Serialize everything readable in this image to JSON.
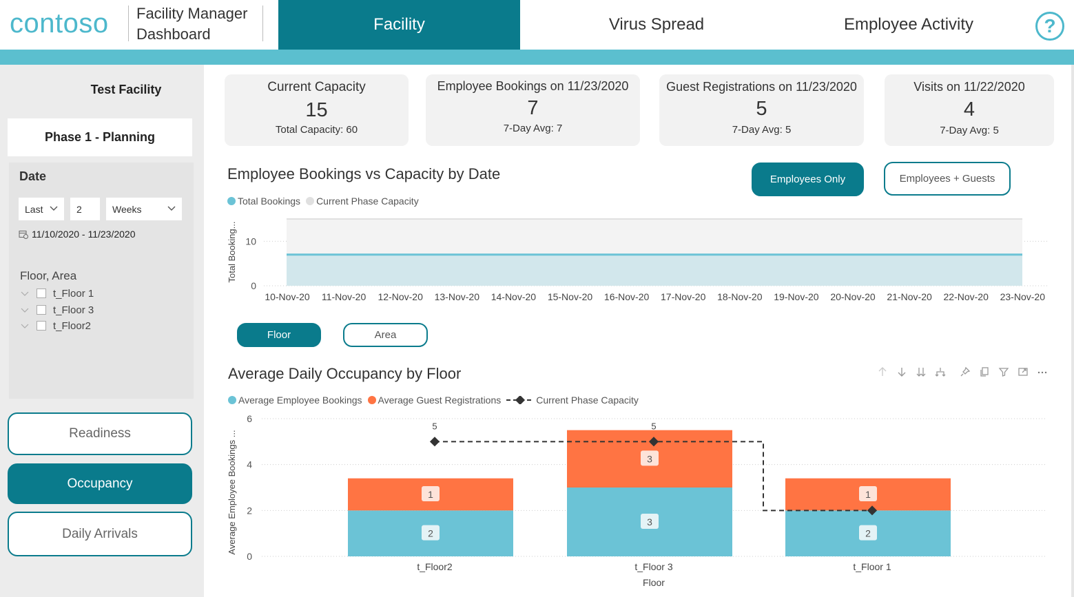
{
  "header": {
    "logo": "contoso",
    "app_title": "Facility Manager Dashboard",
    "tabs": [
      {
        "label": "Facility",
        "active": true
      },
      {
        "label": "Virus Spread",
        "active": false
      },
      {
        "label": "Employee Activity",
        "active": false
      }
    ],
    "help_icon": "question-mark-icon"
  },
  "sidebar": {
    "facility_name": "Test Facility",
    "phase": "Phase 1 - Planning",
    "date": {
      "label": "Date",
      "relative": "Last",
      "count": "2",
      "unit": "Weeks",
      "range": "11/10/2020 - 11/23/2020"
    },
    "floor_area": {
      "title": "Floor, Area",
      "items": [
        "t_Floor 1",
        "t_Floor 3",
        "t_Floor2"
      ]
    },
    "buttons": [
      {
        "label": "Readiness",
        "active": false
      },
      {
        "label": "Occupancy",
        "active": true
      },
      {
        "label": "Daily Arrivals",
        "active": false
      }
    ]
  },
  "kpis": [
    {
      "title": "Current Capacity",
      "value": "15",
      "sub": "Total Capacity: 60"
    },
    {
      "title": "Employee Bookings on 11/23/2020",
      "value": "7",
      "sub": "7-Day Avg: 7"
    },
    {
      "title": "Guest Registrations on 11/23/2020",
      "value": "5",
      "sub": "7-Day Avg: 5"
    },
    {
      "title": "Visits on 11/22/2020",
      "value": "4",
      "sub": "7-Day Avg: 5"
    }
  ],
  "bookings_section": {
    "toggle_employees": "Employees Only",
    "toggle_guests": "Employees + Guests"
  },
  "occupancy_section": {
    "toggle_floor": "Floor",
    "toggle_area": "Area",
    "toolbar_icons": [
      "sort-ascending-icon",
      "sort-descending-icon",
      "expand-all-icon",
      "drill-hierarchy-icon",
      "pin-icon",
      "copy-icon",
      "filter-icon",
      "focus-mode-icon",
      "more-options-icon"
    ]
  },
  "colors": {
    "primary": "#0a7b8c",
    "accent": "#5bbfcf",
    "employee_series": "#6bc3d6",
    "guest_series": "#ff7443",
    "capacity_line": "#333333"
  },
  "chart_data": [
    {
      "type": "area",
      "title": "Employee Bookings vs Capacity by Date",
      "ylabel": "Total Booking...",
      "x": [
        "10-Nov-20",
        "11-Nov-20",
        "12-Nov-20",
        "13-Nov-20",
        "14-Nov-20",
        "15-Nov-20",
        "16-Nov-20",
        "17-Nov-20",
        "18-Nov-20",
        "19-Nov-20",
        "20-Nov-20",
        "21-Nov-20",
        "22-Nov-20",
        "23-Nov-20"
      ],
      "yticks": [
        0,
        10
      ],
      "ylim": [
        0,
        15
      ],
      "grid": true,
      "legend": "top-left",
      "series": [
        {
          "name": "Total Bookings",
          "color": "#6bc3d6",
          "values": [
            7,
            7,
            7,
            7,
            7,
            7,
            7,
            7,
            7,
            7,
            7,
            7,
            7,
            7
          ]
        },
        {
          "name": "Current Phase Capacity",
          "color": "#e0e0e0",
          "values": [
            15,
            15,
            15,
            15,
            15,
            15,
            15,
            15,
            15,
            15,
            15,
            15,
            15,
            15
          ]
        }
      ]
    },
    {
      "type": "bar",
      "stacked": true,
      "title": "Average Daily Occupancy by Floor",
      "xlabel": "Floor",
      "ylabel": "Average Employee Bookings ...",
      "categories": [
        "t_Floor2",
        "t_Floor 3",
        "t_Floor 1"
      ],
      "ylim": [
        0,
        6
      ],
      "yticks": [
        0,
        2,
        4,
        6
      ],
      "grid": true,
      "legend": "top-left",
      "series": [
        {
          "name": "Average Employee Bookings",
          "color": "#6bc3d6",
          "values": [
            2,
            3,
            2
          ],
          "labels": [
            "2",
            "3",
            "2"
          ]
        },
        {
          "name": "Average Guest Registrations",
          "color": "#ff7443",
          "values": [
            1.4,
            2.5,
            1.4
          ],
          "labels": [
            "1",
            "3",
            "1"
          ]
        }
      ],
      "line": {
        "name": "Current Phase Capacity",
        "color": "#333333",
        "style": "dashed-step",
        "values": [
          5,
          5,
          2
        ],
        "labels": [
          "5",
          "5",
          ""
        ]
      }
    }
  ]
}
